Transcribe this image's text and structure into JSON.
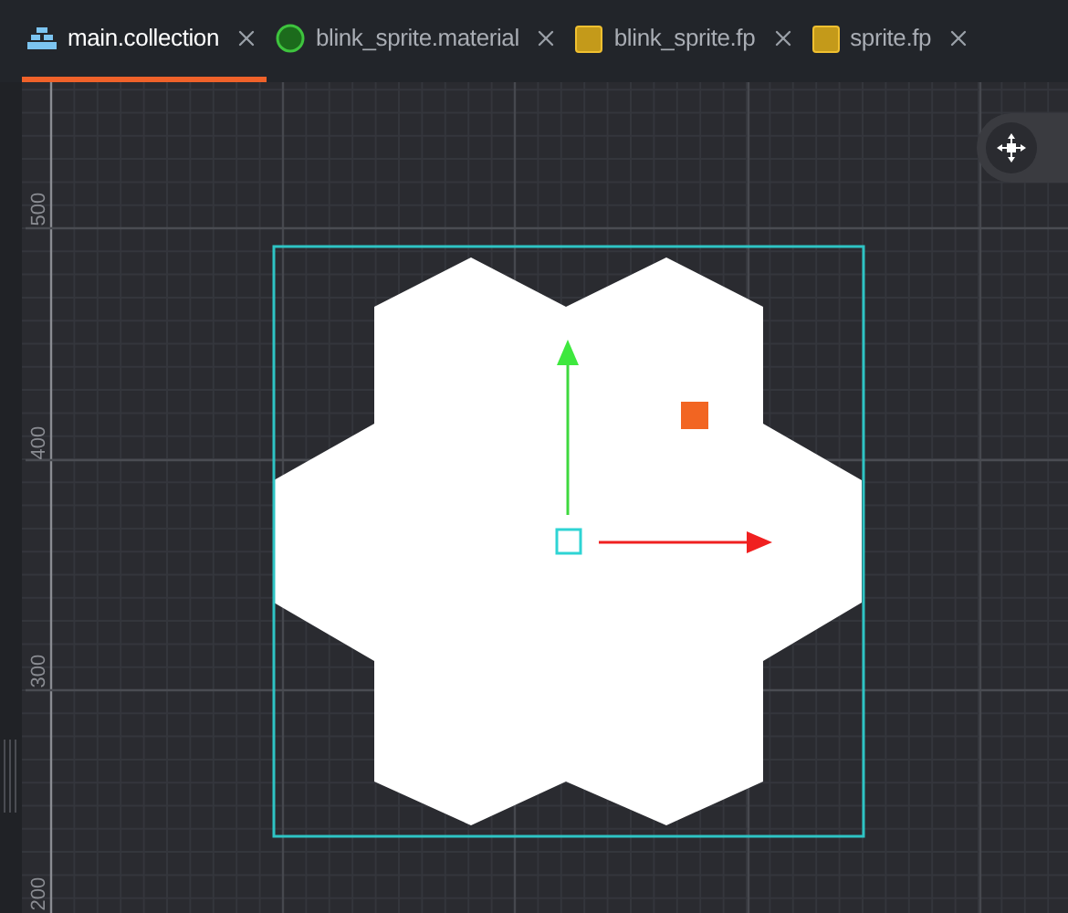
{
  "tabs": [
    {
      "label": "main.collection",
      "kind": "collection",
      "selected": true
    },
    {
      "label": "blink_sprite.material",
      "kind": "material",
      "selected": false
    },
    {
      "label": "blink_sprite.fp",
      "kind": "program",
      "selected": false
    },
    {
      "label": "sprite.fp",
      "kind": "program",
      "selected": false
    }
  ],
  "ruler_labels": [
    "500",
    "400",
    "300",
    "200"
  ]
}
